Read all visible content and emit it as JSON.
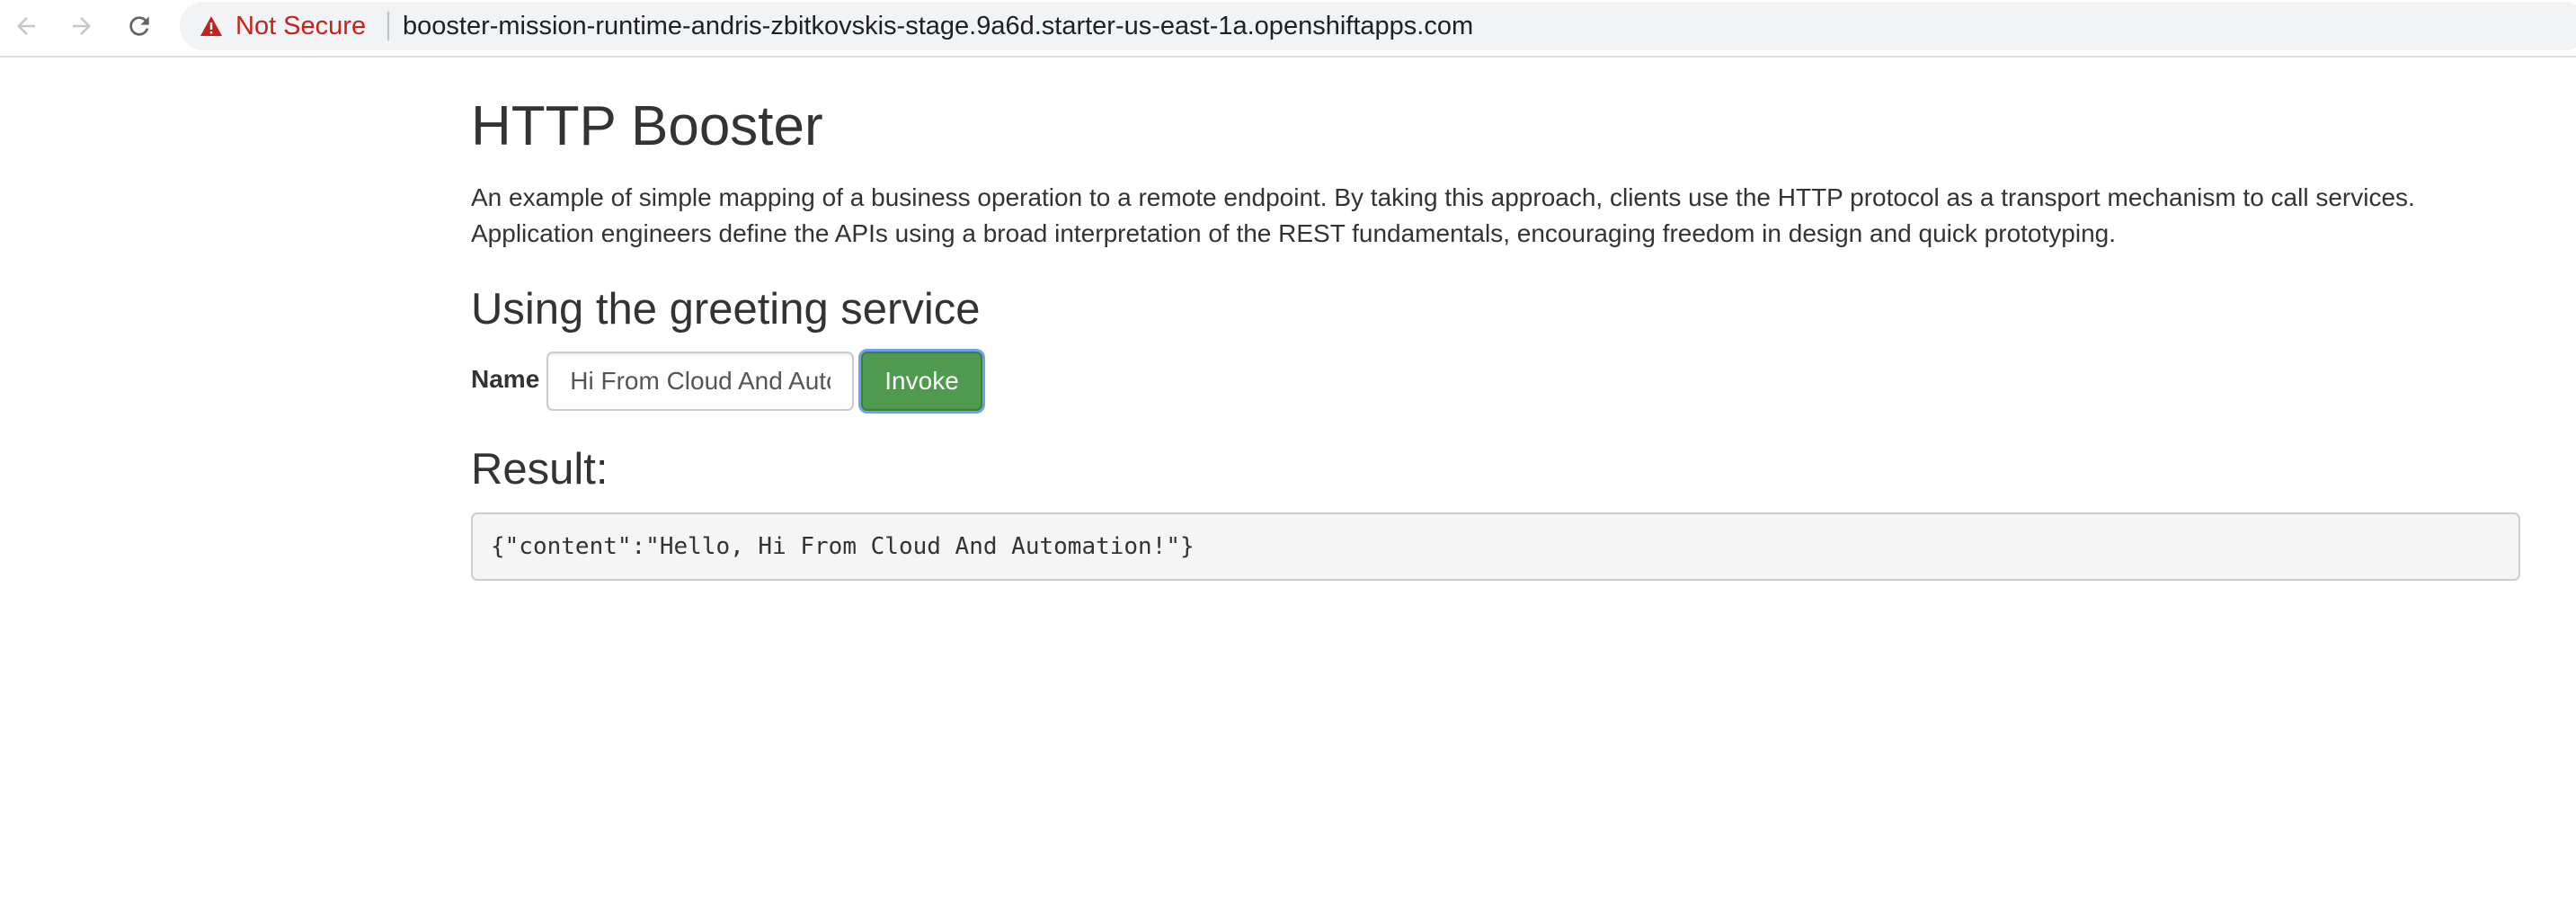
{
  "browser": {
    "security": {
      "icon": "warning-triangle-icon",
      "label": "Not Secure",
      "color": "#c5221f"
    },
    "url": "booster-mission-runtime-andris-zbitkovskis-stage.9a6d.starter-us-east-1a.openshiftapps.com",
    "nav": {
      "back_icon": "arrow-left-icon",
      "forward_icon": "arrow-right-icon",
      "reload_icon": "reload-icon"
    }
  },
  "page": {
    "title": "HTTP Booster",
    "intro": "An example of simple mapping of a business operation to a remote endpoint. By taking this approach, clients use the HTTP protocol as a transport mechanism to call services. Application engineers define the APIs using a broad interpretation of the REST fundamentals, encouraging freedom in design and quick prototyping.",
    "section_title": "Using the greeting service",
    "form": {
      "name_label": "Name",
      "name_value": "Hi From Cloud And Automation",
      "invoke_label": "Invoke"
    },
    "result_title": "Result:",
    "result_output": "{\"content\":\"Hello, Hi From Cloud And Automation!\"}"
  },
  "colors": {
    "invoke_button": "#4f9a4f",
    "focus_ring": "#6ea0f0",
    "text": "#333333"
  }
}
